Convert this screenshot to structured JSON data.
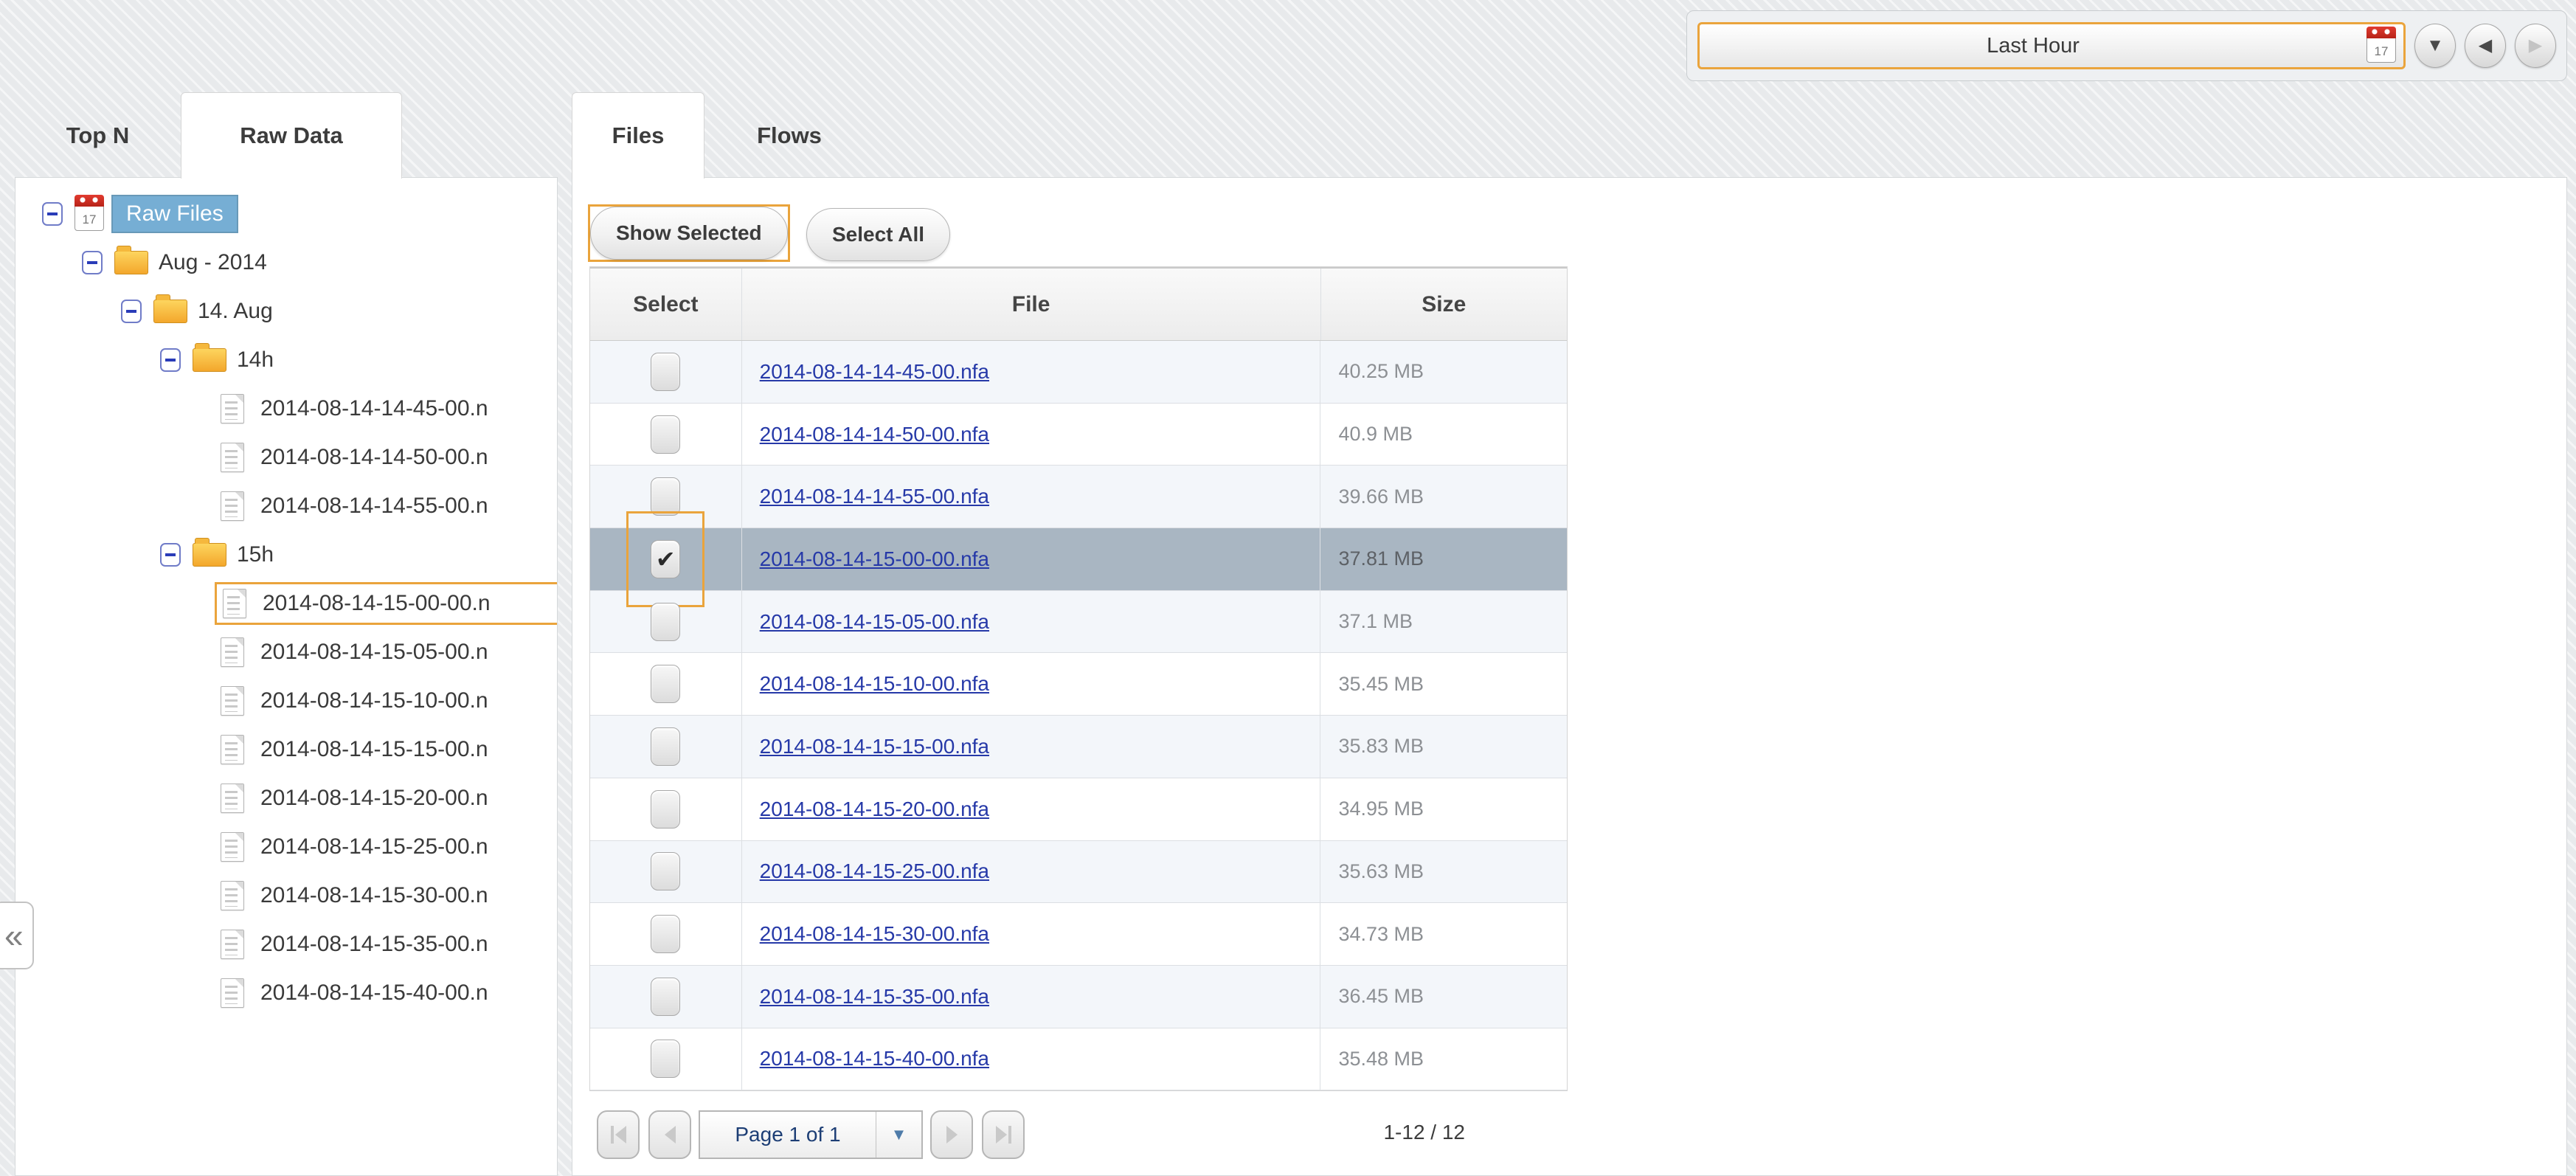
{
  "timebar": {
    "range_label": "Last Hour",
    "calendar_day": "17"
  },
  "left_tabs": {
    "top_n": "Top N",
    "raw_data": "Raw Data"
  },
  "main_tabs": {
    "files": "Files",
    "flows": "Flows"
  },
  "toolbar": {
    "show_selected": "Show Selected",
    "select_all": "Select All"
  },
  "tree": {
    "nodes": [
      {
        "label": "Raw Files"
      },
      {
        "label": "Aug - 2014"
      },
      {
        "label": "14. Aug"
      },
      {
        "label": "14h"
      },
      {
        "label": "2014-08-14-14-45-00.n"
      },
      {
        "label": "2014-08-14-14-50-00.n"
      },
      {
        "label": "2014-08-14-14-55-00.n"
      },
      {
        "label": "15h"
      },
      {
        "label": "2014-08-14-15-00-00.n"
      },
      {
        "label": "2014-08-14-15-05-00.n"
      },
      {
        "label": "2014-08-14-15-10-00.n"
      },
      {
        "label": "2014-08-14-15-15-00.n"
      },
      {
        "label": "2014-08-14-15-20-00.n"
      },
      {
        "label": "2014-08-14-15-25-00.n"
      },
      {
        "label": "2014-08-14-15-30-00.n"
      },
      {
        "label": "2014-08-14-15-35-00.n"
      },
      {
        "label": "2014-08-14-15-40-00.n"
      }
    ]
  },
  "table": {
    "columns": [
      "Select",
      "File",
      "Size"
    ],
    "rows": [
      {
        "file": "2014-08-14-14-45-00.nfa",
        "size": "40.25 MB",
        "checked": false
      },
      {
        "file": "2014-08-14-14-50-00.nfa",
        "size": "40.9 MB",
        "checked": false
      },
      {
        "file": "2014-08-14-14-55-00.nfa",
        "size": "39.66 MB",
        "checked": false
      },
      {
        "file": "2014-08-14-15-00-00.nfa",
        "size": "37.81 MB",
        "checked": true
      },
      {
        "file": "2014-08-14-15-05-00.nfa",
        "size": "37.1 MB",
        "checked": false
      },
      {
        "file": "2014-08-14-15-10-00.nfa",
        "size": "35.45 MB",
        "checked": false
      },
      {
        "file": "2014-08-14-15-15-00.nfa",
        "size": "35.83 MB",
        "checked": false
      },
      {
        "file": "2014-08-14-15-20-00.nfa",
        "size": "34.95 MB",
        "checked": false
      },
      {
        "file": "2014-08-14-15-25-00.nfa",
        "size": "35.63 MB",
        "checked": false
      },
      {
        "file": "2014-08-14-15-30-00.nfa",
        "size": "34.73 MB",
        "checked": false
      },
      {
        "file": "2014-08-14-15-35-00.nfa",
        "size": "36.45 MB",
        "checked": false
      },
      {
        "file": "2014-08-14-15-40-00.nfa",
        "size": "35.48 MB",
        "checked": false
      }
    ]
  },
  "pagination": {
    "page_label": "Page 1 of 1",
    "range_text": "1-12 / 12"
  },
  "icons": {
    "collapse": "«",
    "check": "✔",
    "dropdown_triangle": "▼",
    "down_triangle": "▼",
    "left_triangle": "◀",
    "right_triangle": "▶"
  },
  "colors": {
    "accent_orange": "#EAA43C",
    "tree_selection_blue": "#76AED4",
    "selected_row": "#A9B6C2",
    "link_blue": "#2639A8"
  }
}
